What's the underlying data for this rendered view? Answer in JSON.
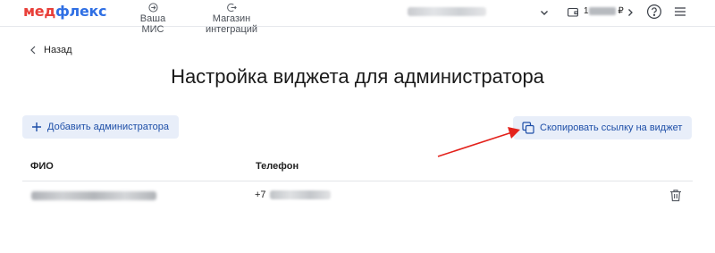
{
  "header": {
    "logo_part1": "мед",
    "logo_part2": "флекс",
    "nav": [
      {
        "label": "Ваша МИС",
        "icon": "login-arrow-icon"
      },
      {
        "label": "Магазин интеграций",
        "icon": "logout-arrow-icon"
      }
    ],
    "balance_currency": "₽",
    "balance_prefix": "1",
    "icons": [
      "chevron-down-icon",
      "wallet-icon",
      "chevron-right-icon",
      "help-circle-icon",
      "hamburger-menu-icon"
    ]
  },
  "back": {
    "label": "Назад"
  },
  "page": {
    "title": "Настройка виджета для администратора"
  },
  "actions": {
    "add_admin_label": "Добавить администратора",
    "copy_link_label": "Скопировать ссылку на виджет"
  },
  "table": {
    "columns": [
      "ФИО",
      "Телефон"
    ],
    "rows": [
      {
        "phone_prefix": "+7"
      }
    ]
  },
  "colors": {
    "brand_red": "#e8403a",
    "brand_blue": "#2f6fe4",
    "button_bg": "#e8eef9",
    "button_text": "#1e4fa8",
    "annotation_arrow": "#e3221c"
  }
}
